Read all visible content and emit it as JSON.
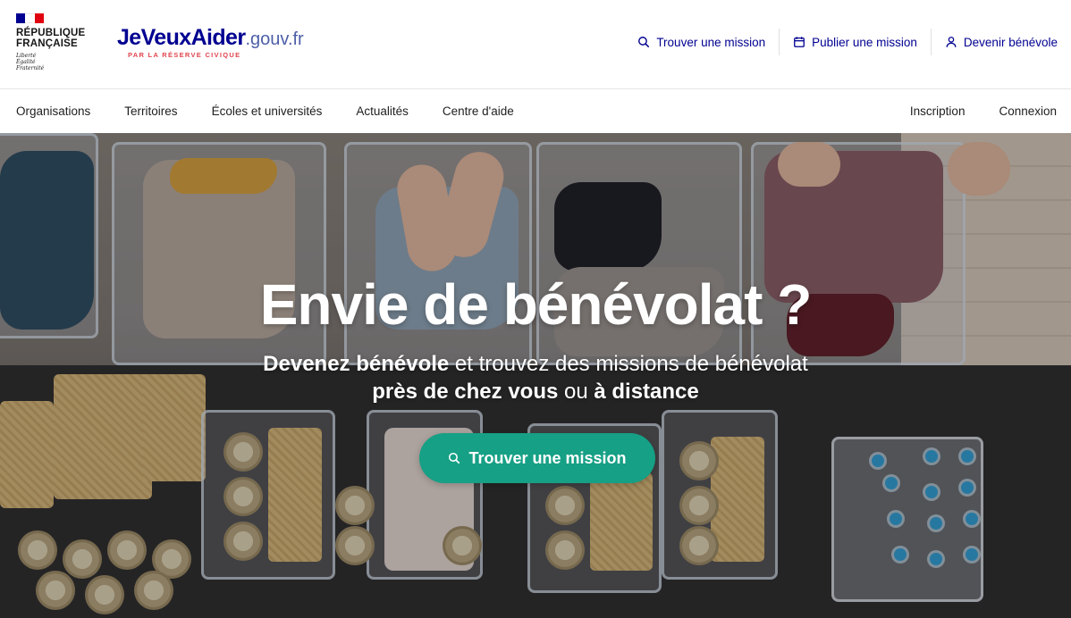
{
  "header": {
    "republic": {
      "line1": "RÉPUBLIQUE",
      "line2": "FRANÇAISE",
      "motto": [
        "Liberté",
        "Égalité",
        "Fraternité"
      ]
    },
    "brand": {
      "name": "JeVeuxAider",
      "suffix": ".gouv.fr",
      "tagline": "PAR LA RÉSERVE CIVIQUE"
    },
    "links": [
      {
        "label": "Trouver une mission",
        "icon": "search-icon"
      },
      {
        "label": "Publier une mission",
        "icon": "calendar-icon"
      },
      {
        "label": "Devenir bénévole",
        "icon": "user-icon"
      }
    ]
  },
  "nav": {
    "left": [
      "Organisations",
      "Territoires",
      "Écoles et universités",
      "Actualités",
      "Centre d'aide"
    ],
    "right": [
      "Inscription",
      "Connexion"
    ]
  },
  "hero": {
    "title": "Envie de bénévolat ?",
    "sub_line1_bold": "Devenez bénévole",
    "sub_line1_rest": " et trouvez des missions de bénévolat",
    "sub_line2_bold1": "près de chez vous",
    "sub_line2_mid": " ou ",
    "sub_line2_bold2": "à distance",
    "cta_label": "Trouver une mission",
    "cta_icon": "search-icon"
  },
  "colors": {
    "brand_blue": "#000091",
    "flag_red": "#e1000f",
    "cta_green": "#16a085"
  }
}
